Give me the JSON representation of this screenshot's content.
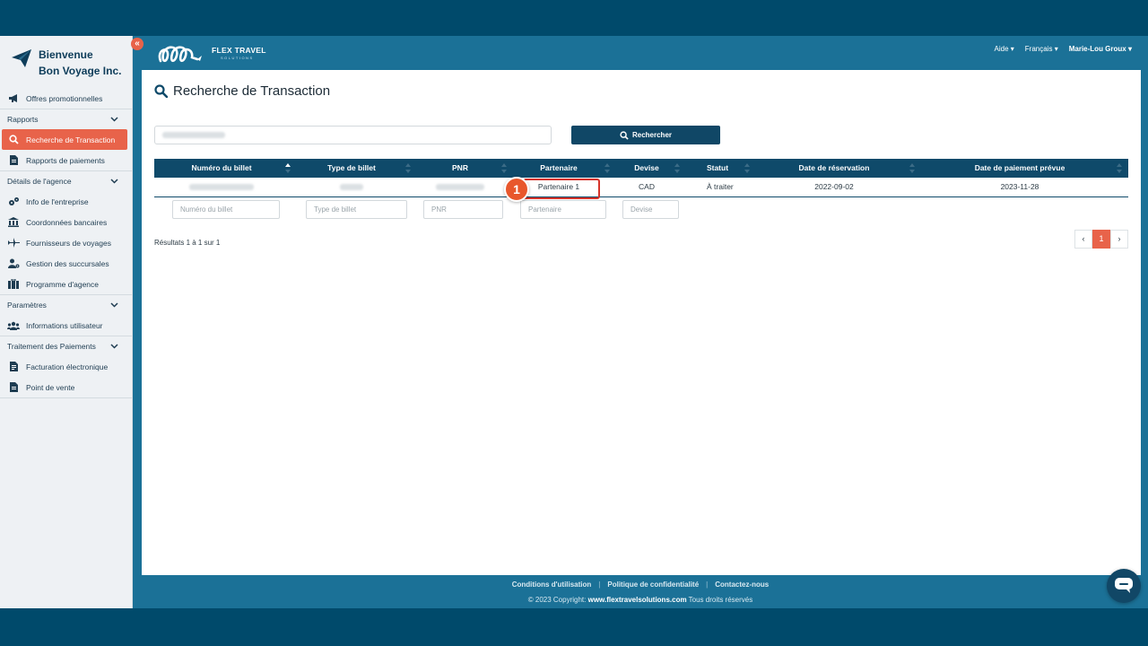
{
  "sidebar": {
    "welcome": "Bienvenue",
    "company": "Bon Voyage Inc.",
    "items": {
      "promo": "Offres promotionnelles",
      "rapports": "Rapports",
      "recherche": "Recherche de Transaction",
      "paiements": "Rapports de paiements",
      "details": "Détails de l'agence",
      "info": "Info de l'entreprise",
      "bancaires": "Coordonnées bancaires",
      "fournisseurs": "Fournisseurs de voyages",
      "succursales": "Gestion des succursales",
      "programme": "Programme d'agence",
      "parametres": "Paramètres",
      "utilisateur": "Informations utilisateur",
      "traitement": "Traitement des Paiements",
      "facturation": "Facturation électronique",
      "pointvente": "Point de vente"
    }
  },
  "header": {
    "logo_text": "FLEX TRAVEL",
    "logo_sub": "SOLUTIONS",
    "help": "Aide",
    "language": "Français",
    "user": "Marie-Lou Groux"
  },
  "main": {
    "title": "Recherche de Transaction",
    "search_button": "Rechercher",
    "columns": {
      "ticket": "Numéro du billet",
      "type": "Type de billet",
      "pnr": "PNR",
      "partner": "Partenaire",
      "currency": "Devise",
      "status": "Statut",
      "booking_date": "Date de réservation",
      "payment_date": "Date de paiement prévue"
    },
    "row": {
      "partner": "Partenaire 1",
      "currency": "CAD",
      "status": "À traiter",
      "booking_date": "2022-09-02",
      "payment_date": "2023-11-28"
    },
    "filters": {
      "ticket": "Numéro du billet",
      "type": "Type de billet",
      "pnr": "PNR",
      "partner": "Partenaire",
      "currency": "Devise"
    },
    "results": "Résultats 1 à 1 sur 1",
    "pager": {
      "prev": "‹",
      "current": "1",
      "next": "›"
    },
    "step": "1"
  },
  "footer": {
    "terms": "Conditions d'utilisation",
    "privacy": "Politique de confidentialité",
    "contact": "Contactez-nous",
    "copyright": "© 2023 Copyright:",
    "site": "www.flextravelsolutions.com",
    "rights": "Tous droits réservés"
  },
  "colors": {
    "accent": "#e8634a",
    "navy": "#0f4a6a",
    "header": "#1b7197",
    "highlight": "#d6332a"
  }
}
